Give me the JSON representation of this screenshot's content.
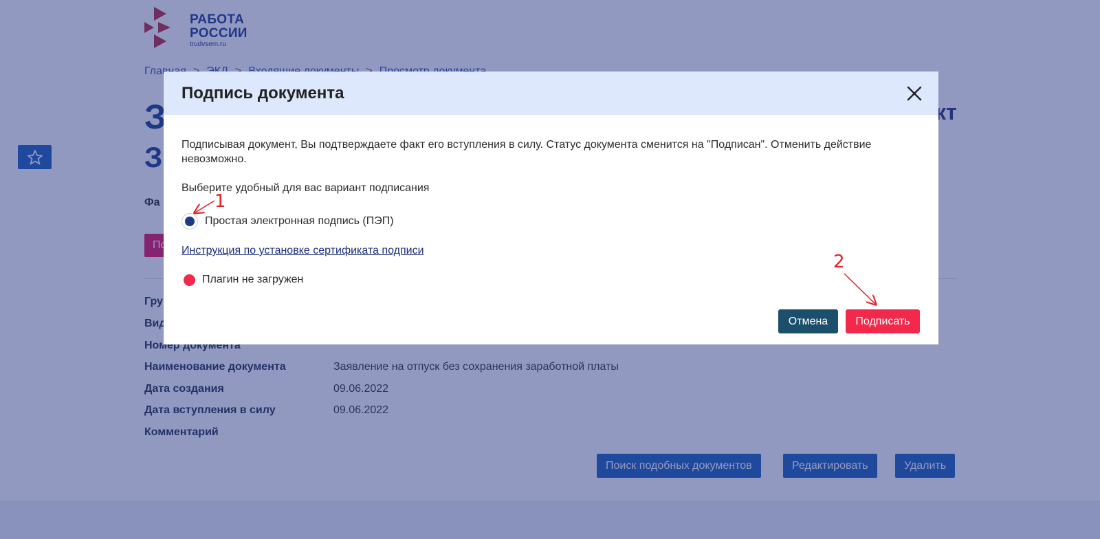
{
  "logo": {
    "line1": "РАБОТА",
    "line2": "РОССИИ",
    "sub": "trudvsem.ru"
  },
  "breadcrumb": {
    "items": [
      "Главная",
      "ЭКД",
      "Входящие документы",
      "Просмотр документа"
    ],
    "sep": ">"
  },
  "colors": {
    "brand": "#1b3a8c",
    "primary_button": "#1b5fb8",
    "danger": "#f2294a",
    "cancel_button": "#1c4f6c",
    "overlay": "rgba(36,52,130,0.5)",
    "modal_header": "#dde8fc",
    "annotation": "#e3202a"
  },
  "page": {
    "title_fragment_1": "З",
    "title_fragment_2": "З",
    "title_tail": "кт",
    "file_label_fragment": "Фа",
    "pink_button_fragment": "По",
    "fields": [
      {
        "label": "Гру",
        "value": ""
      },
      {
        "label": "Вид",
        "value": ""
      },
      {
        "label": "Номер документа",
        "value": ""
      },
      {
        "label": "Наименование документа",
        "value": "Заявление на отпуск без сохранения заработной платы"
      },
      {
        "label": "Дата создания",
        "value": "09.06.2022"
      },
      {
        "label": "Дата вступления в силу",
        "value": "09.06.2022"
      },
      {
        "label": "Комментарий",
        "value": ""
      }
    ],
    "actions": {
      "search_similar": "Поиск подобных документов",
      "edit": "Редактировать",
      "delete": "Удалить"
    }
  },
  "modal": {
    "title": "Подпись документа",
    "description": "Подписывая документ, Вы подтверждаете факт его вступления в силу. Статус документа сменится на \"Подписан\". Отменить действие невозможно.",
    "choose_label": "Выберите удобный для вас вариант подписания",
    "option_label": "Простая электронная подпись (ПЭП)",
    "option_selected": true,
    "instruction_link": "Инструкция по установке сертификата подписи",
    "plugin_status": "Плагин не загружен",
    "cancel_label": "Отмена",
    "sign_label": "Подписать"
  },
  "annotations": {
    "marker_1": "1",
    "marker_2": "2"
  }
}
